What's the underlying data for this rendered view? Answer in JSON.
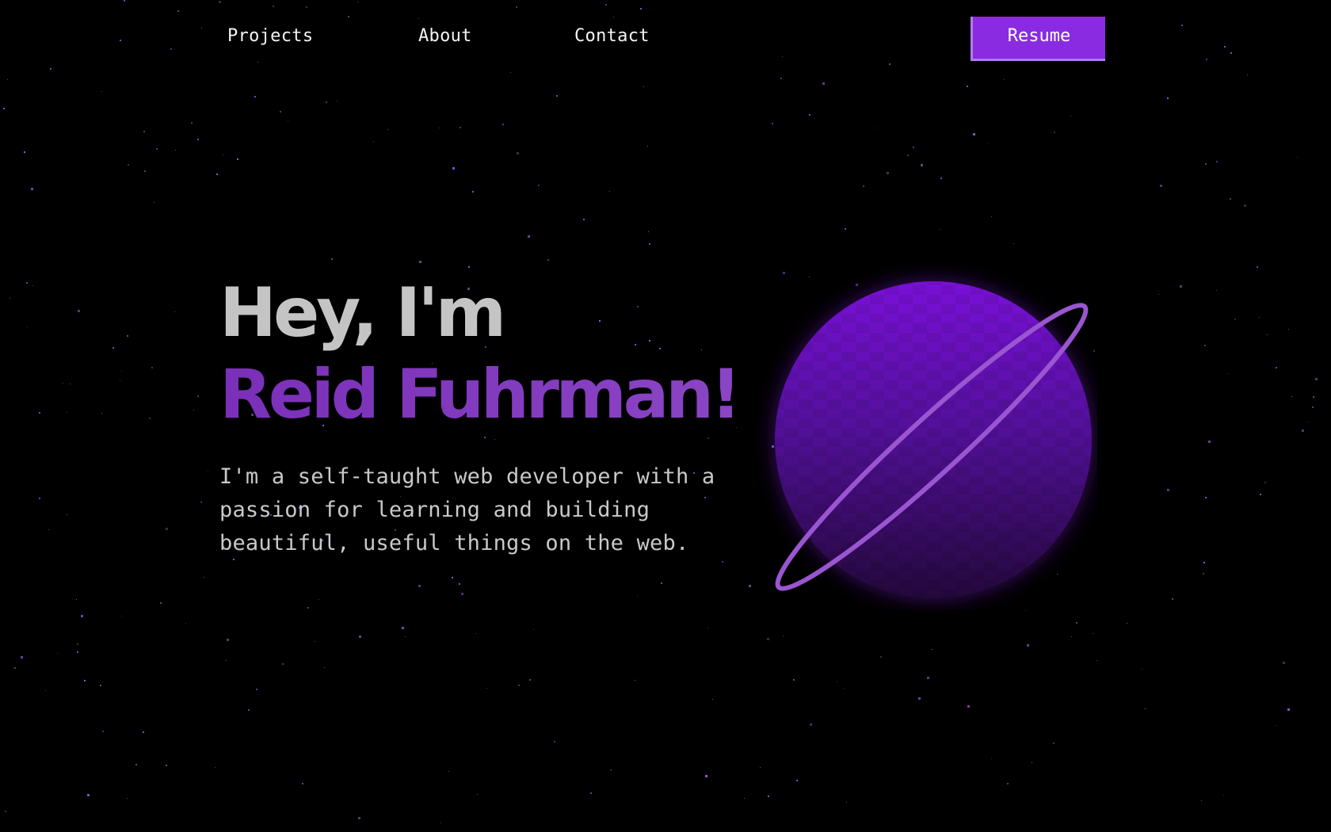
{
  "nav": {
    "links": [
      {
        "label": "Projects"
      },
      {
        "label": "About"
      },
      {
        "label": "Contact"
      }
    ],
    "resume_label": "Resume"
  },
  "hero": {
    "greeting": "Hey, I'm",
    "name": "Reid Fuhrman!",
    "description": "I'm a self-taught web developer with a passion for learning and building beautiful, useful things on the web."
  },
  "colors": {
    "background": "#000000",
    "accent": "#8a2be2",
    "name_text": "#7f3bbf",
    "planet_top": "#7a10d8",
    "planet_bottom": "#2a0a44",
    "ring": "#9a55d0"
  },
  "icons": {
    "illustration": "planet-icon"
  }
}
